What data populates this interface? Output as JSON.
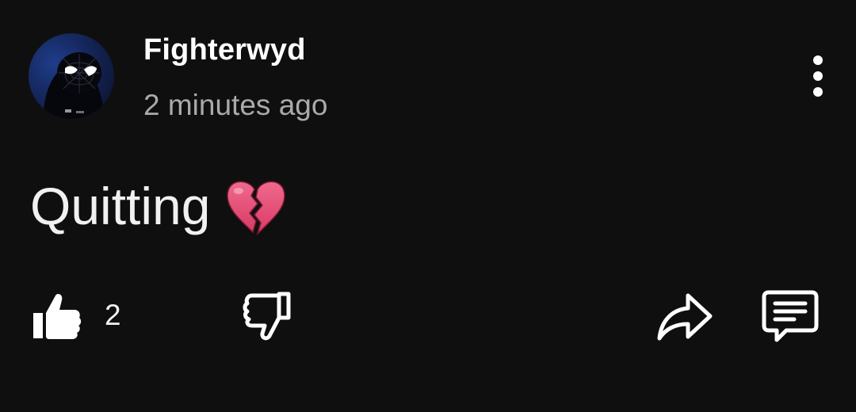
{
  "comment": {
    "author": "Fighterwyd",
    "timestamp": "2 minutes ago",
    "text": "Quitting",
    "emoji_icon": "broken-heart-icon",
    "avatar_icon": "spider-mask-avatar"
  },
  "actions": {
    "like_icon": "thumbs-up-icon",
    "like_count": "2",
    "dislike_icon": "thumbs-down-icon",
    "share_icon": "share-arrow-icon",
    "reply_icon": "comment-bubble-icon",
    "menu_icon": "more-vertical-icon"
  },
  "colors": {
    "background": "#0f0f0f",
    "text_primary": "#f1f1f1",
    "text_secondary": "#aaaaaa",
    "heart": "#e0456f"
  }
}
